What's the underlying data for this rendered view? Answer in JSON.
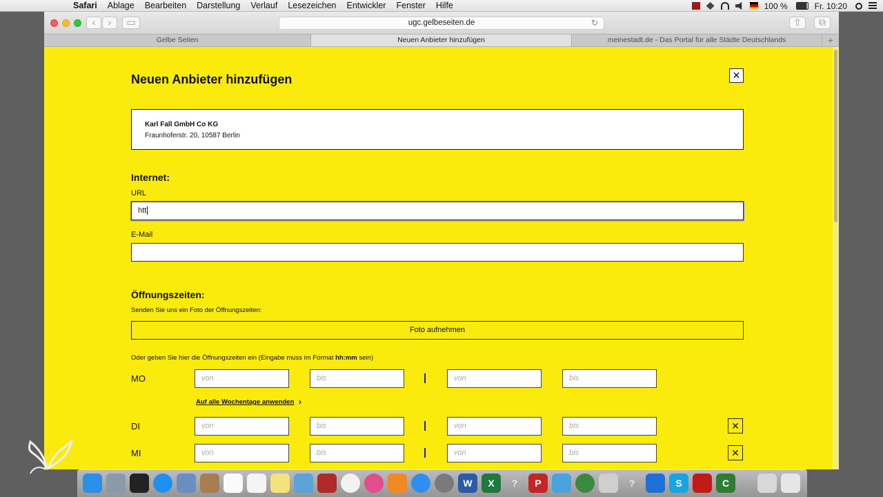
{
  "menubar": {
    "app": "Safari",
    "items": [
      "Ablage",
      "Bearbeiten",
      "Darstellung",
      "Verlauf",
      "Lesezeichen",
      "Entwickler",
      "Fenster",
      "Hilfe"
    ],
    "battery": "100 %",
    "clock": "Fr. 10:20"
  },
  "browser": {
    "url": "ugc.gelbeseiten.de",
    "tabs": [
      {
        "label": "Gelbe Seiten"
      },
      {
        "label": "Neuen Anbieter hinzufügen"
      },
      {
        "label": "meinestadt.de - Das Portal für alle Städte Deutschlands"
      }
    ]
  },
  "dialog": {
    "title": "Neuen Anbieter hinzufügen",
    "close": "✕",
    "provider": {
      "name": "Karl Fall GmbH Co KG",
      "address": "Fraunhoferstr. 20, 10587 Berlin"
    },
    "internet": {
      "heading": "Internet:",
      "url_label": "URL",
      "url_value": "htt",
      "email_label": "E-Mail",
      "email_value": ""
    },
    "hours": {
      "heading": "Öffnungszeiten:",
      "photo_prompt": "Senden Sie uns ein Foto der Öffnungszeiten:",
      "photo_button": "Foto aufnehmen",
      "manual_prefix": "Oder geben Sie hier die Öffnungszeiten ein (Eingabe muss im Format ",
      "manual_format": "hh:mm",
      "manual_suffix": " sein)",
      "placeholder_from": "von",
      "placeholder_to": "bis",
      "apply_all": "Auf alle Wochentage anwenden",
      "days": [
        "MO",
        "DI",
        "MI"
      ]
    }
  },
  "colors": {
    "page_background": "#faeb0c",
    "text": "#111111"
  }
}
